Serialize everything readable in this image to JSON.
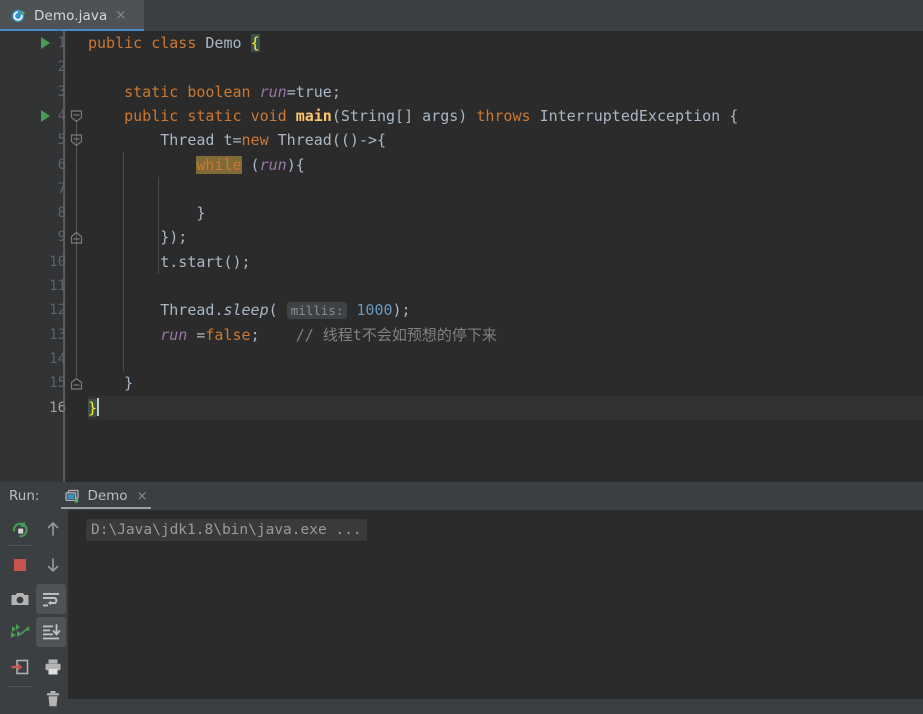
{
  "window": {
    "theme": "darcula",
    "colors": {
      "editor_bg": "#2b2b2b",
      "gutter_bg": "#313335",
      "panel_bg": "#3c3f41",
      "tab_active_bg": "#4e5254",
      "tab_underline": "#4a88c7",
      "keyword": "#cc7832",
      "field": "#9876aa",
      "method": "#ffc66d",
      "number": "#6897bb",
      "comment": "#808080",
      "default_text": "#a9b7c6",
      "brace_match_bg": "#3b514d",
      "brace_match_fg": "#ffef28",
      "search_highlight_bg": "#806a35",
      "run_green": "#499c54",
      "stop_red": "#c75450"
    }
  },
  "editor_tabs": [
    {
      "label": "Demo.java",
      "icon": "java-runnable-class-icon",
      "close_label": "×",
      "active": true
    }
  ],
  "editor": {
    "line_count": 16,
    "current_line": 16,
    "caret_line": 16,
    "caret_column": 2,
    "run_gutter_lines": [
      1,
      4
    ],
    "fold_markers": [
      {
        "line": 4,
        "type": "expanded-down"
      },
      {
        "line": 5,
        "type": "expanded-down"
      },
      {
        "line": 9,
        "type": "expanded-up"
      },
      {
        "line": 15,
        "type": "expanded-up"
      }
    ],
    "lines": [
      {
        "n": 1,
        "text": "public class Demo {"
      },
      {
        "n": 2,
        "text": ""
      },
      {
        "n": 3,
        "text": "    static boolean run=true;"
      },
      {
        "n": 4,
        "text": "    public static void main(String[] args) throws InterruptedException {"
      },
      {
        "n": 5,
        "text": "        Thread t=new Thread(()->{"
      },
      {
        "n": 6,
        "text": "            while (run){"
      },
      {
        "n": 7,
        "text": ""
      },
      {
        "n": 8,
        "text": "            }"
      },
      {
        "n": 9,
        "text": "        });"
      },
      {
        "n": 10,
        "text": "        t.start();"
      },
      {
        "n": 11,
        "text": ""
      },
      {
        "n": 12,
        "text": "        Thread.sleep( millis: 1000);"
      },
      {
        "n": 13,
        "text": "        run =false;    // 线程t不会如预想的停下来"
      },
      {
        "n": 14,
        "text": ""
      },
      {
        "n": 15,
        "text": "    }"
      },
      {
        "n": 16,
        "text": "}"
      }
    ],
    "tokens": {
      "l1": [
        "public",
        "class",
        "Demo",
        "{"
      ],
      "l3": [
        "static",
        "boolean",
        "run",
        "=true;"
      ],
      "l4": [
        "public",
        "static",
        "void",
        "main",
        "(String[] args)",
        "throws",
        "InterruptedException",
        "{"
      ],
      "l5": [
        "Thread t=",
        "new",
        " Thread(()->{"
      ],
      "l6": [
        "while",
        " (",
        "run",
        "){"
      ],
      "l8": [
        "}"
      ],
      "l9": [
        "});"
      ],
      "l10": [
        "t.start();"
      ],
      "l12": [
        "Thread.",
        "sleep",
        "(",
        "millis:",
        "1000",
        ");"
      ],
      "l13": [
        "run",
        " =",
        "false",
        ";",
        "// 线程t不会如预想的停下来"
      ],
      "l15": [
        "}"
      ],
      "l16": [
        "}"
      ]
    },
    "parameter_hint": "millis:",
    "comment_text": "// 线程t不会如预想的停下来",
    "highlighted_keyword": "while"
  },
  "run_window": {
    "title": "Run:",
    "tab": {
      "label": "Demo",
      "icon": "run-configuration-icon",
      "close_label": "×",
      "active": true
    },
    "console_output": "D:\\Java\\jdk1.8\\bin\\java.exe ...",
    "toolbar": [
      {
        "name": "rerun-button",
        "tooltip": "Rerun 'Demo'",
        "toggled": false
      },
      {
        "name": "up-arrow-button",
        "tooltip": "Up the Stack Trace",
        "toggled": false
      },
      {
        "name": "stop-button",
        "tooltip": "Stop 'Demo'",
        "toggled": false
      },
      {
        "name": "down-arrow-button",
        "tooltip": "Down the Stack Trace",
        "toggled": false
      },
      {
        "name": "screenshot-button",
        "tooltip": "Capture Screenshot",
        "toggled": false
      },
      {
        "name": "soft-wrap-button",
        "tooltip": "Soft-Wrap",
        "toggled": true
      },
      {
        "name": "thread-dump-button",
        "tooltip": "Get Thread Dump",
        "toggled": false
      },
      {
        "name": "scroll-to-end-button",
        "tooltip": "Scroll to the end",
        "toggled": true
      },
      {
        "name": "export-button",
        "tooltip": "Export to Text File",
        "toggled": false
      },
      {
        "name": "print-button",
        "tooltip": "Print",
        "toggled": false
      },
      {
        "name": "clear-all-button",
        "tooltip": "Clear All",
        "toggled": false
      }
    ]
  }
}
